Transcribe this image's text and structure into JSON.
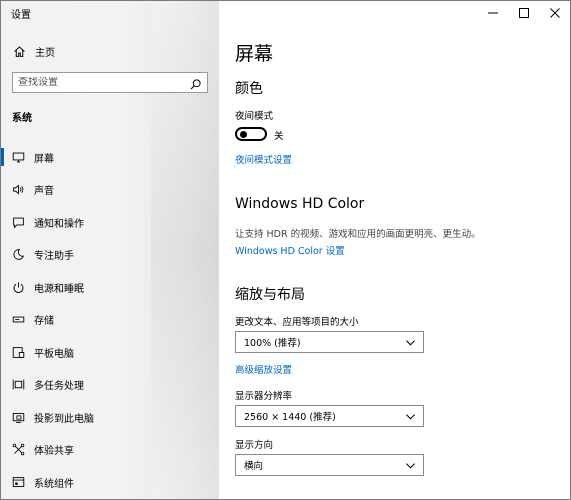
{
  "window": {
    "title": "设置"
  },
  "sidebar": {
    "home_label": "主页",
    "search_placeholder": "查找设置",
    "section_label": "系统",
    "items": [
      {
        "label": "屏幕",
        "icon": "monitor-icon",
        "active": true
      },
      {
        "label": "声音",
        "icon": "speaker-icon",
        "active": false
      },
      {
        "label": "通知和操作",
        "icon": "notification-icon",
        "active": false
      },
      {
        "label": "专注助手",
        "icon": "moon-icon",
        "active": false
      },
      {
        "label": "电源和睡眠",
        "icon": "power-icon",
        "active": false
      },
      {
        "label": "存储",
        "icon": "storage-icon",
        "active": false
      },
      {
        "label": "平板电脑",
        "icon": "tablet-icon",
        "active": false
      },
      {
        "label": "多任务处理",
        "icon": "multitasking-icon",
        "active": false
      },
      {
        "label": "投影到此电脑",
        "icon": "projection-icon",
        "active": false
      },
      {
        "label": "体验共享",
        "icon": "share-icon",
        "active": false
      },
      {
        "label": "系统组件",
        "icon": "components-icon",
        "active": false
      }
    ]
  },
  "main": {
    "title": "屏幕",
    "color_section": {
      "heading": "颜色",
      "night_light_label": "夜间模式",
      "night_light_state": "关",
      "night_light_link": "夜间模式设置"
    },
    "hdr_section": {
      "heading": "Windows HD Color",
      "description": "让支持 HDR 的视频、游戏和应用的画面更明亮、更生动。",
      "link": "Windows HD Color 设置"
    },
    "scale_section": {
      "heading": "缩放与布局",
      "scale_label": "更改文本、应用等项目的大小",
      "scale_value": "100% (推荐)",
      "advanced_link": "高级缩放设置",
      "resolution_label": "显示器分辨率",
      "resolution_value": "2560 × 1440 (推荐)",
      "orientation_label": "显示方向",
      "orientation_value": "横向"
    }
  },
  "colors": {
    "accent": "#0067c0",
    "active_indicator": "#0063b1"
  }
}
